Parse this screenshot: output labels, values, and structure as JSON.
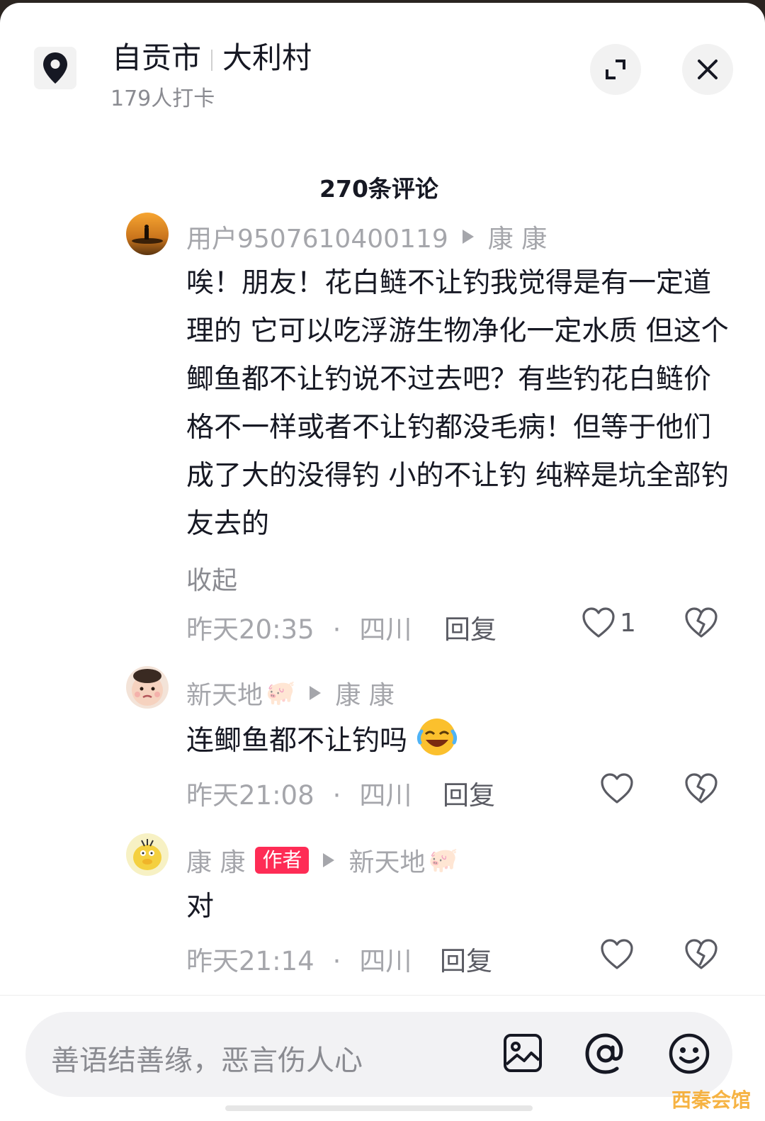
{
  "header": {
    "city": "自贡市",
    "village": "大利村",
    "checkins": "179人打卡"
  },
  "comments_title": "270条评论",
  "comments": [
    {
      "user": "用户9507610400119",
      "reply_to": "康 康",
      "text": "唉！朋友！花白鲢不让钓我觉得是有一定道理的 它可以吃浮游生物净化一定水质 但这个鲫鱼都不让钓说不过去吧？有些钓花白鲢价格不一样或者不让钓都没毛病！但等于他们成了大的没得钓 小的不让钓 纯粹是坑全部钓友去的",
      "collapse_label": "收起",
      "time": "昨天20:35",
      "region": "四川",
      "reply_label": "回复",
      "likes": "1"
    },
    {
      "user": "新天地",
      "reply_to": "康 康",
      "text": "连鲫鱼都不让钓吗",
      "time": "昨天21:08",
      "region": "四川",
      "reply_label": "回复"
    },
    {
      "user": "康 康",
      "badge": "作者",
      "reply_to": "新天地",
      "text": "对",
      "time": "昨天21:14",
      "region": "四川",
      "reply_label": "回复"
    }
  ],
  "input": {
    "placeholder": "善语结善缘，恶言伤人心"
  },
  "watermark": "西秦会馆",
  "icons": [
    "location-pin-icon",
    "expand-icon",
    "close-icon",
    "heart-icon",
    "broken-heart-icon",
    "image-icon",
    "at-icon",
    "emoji-icon"
  ]
}
